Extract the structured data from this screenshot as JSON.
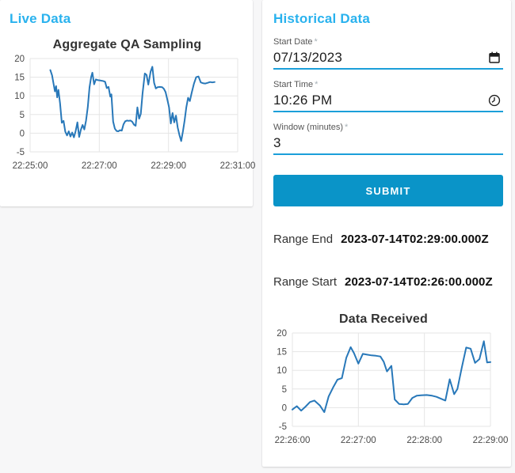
{
  "panels": {
    "live": {
      "heading": "Live Data"
    },
    "historical": {
      "heading": "Historical Data"
    }
  },
  "form": {
    "start_date": {
      "label": "Start Date",
      "required_marker": "*",
      "value": "07/13/2023",
      "icon": "calendar-icon"
    },
    "start_time": {
      "label": "Start Time",
      "required_marker": "*",
      "value": "10:26 PM",
      "icon": "clock-icon"
    },
    "window_minutes": {
      "label": "Window (minutes)",
      "required_marker": "*",
      "value": "3"
    },
    "submit_label": "SUBMIT"
  },
  "results": {
    "range_end": {
      "label": "Range End",
      "value": "2023-07-14T02:29:00.000Z"
    },
    "range_start": {
      "label": "Range Start",
      "value": "2023-07-14T02:26:00.000Z"
    }
  },
  "colors": {
    "page_background": "#f7f7f8",
    "card_background": "#ffffff",
    "panel_heading": "#29b2ee",
    "input_underline": "#1b9fd9",
    "submit_background": "#0a94c8",
    "submit_text": "#ffffff",
    "chart_line": "#2878b9",
    "chart_grid": "#e5e5e5",
    "chart_tick_text": "#4a4a4a",
    "chart_title_text": "#333333",
    "field_label_text": "#565656",
    "field_value_text": "#1d1d1d"
  },
  "chart_data": [
    {
      "id": "live",
      "type": "line",
      "title": "Aggregate QA Sampling",
      "xlabel": "",
      "ylabel": "",
      "grid": true,
      "legend": "none",
      "line_color": "#2878b9",
      "x_tick_labels": [
        "22:25:00",
        "22:27:00",
        "22:29:00",
        "22:31:00"
      ],
      "x_tick_seconds": [
        0,
        120,
        240,
        360
      ],
      "x_range_seconds": [
        0,
        360
      ],
      "y_ticks": [
        -5,
        0,
        5,
        10,
        15,
        20
      ],
      "ylim": [
        -5,
        20
      ],
      "points": [
        [
          35,
          16.9
        ],
        [
          38,
          15.5
        ],
        [
          41,
          13.0
        ],
        [
          43,
          11.2
        ],
        [
          45,
          12.6
        ],
        [
          47,
          9.6
        ],
        [
          49,
          11.6
        ],
        [
          52,
          8.0
        ],
        [
          55,
          2.8
        ],
        [
          58,
          3.3
        ],
        [
          61,
          0.4
        ],
        [
          64,
          -0.6
        ],
        [
          67,
          0.5
        ],
        [
          70,
          -0.9
        ],
        [
          73,
          0.2
        ],
        [
          76,
          -1.1
        ],
        [
          79,
          0.6
        ],
        [
          82,
          2.9
        ],
        [
          85,
          -1.0
        ],
        [
          88,
          0.9
        ],
        [
          91,
          2.2
        ],
        [
          94,
          1.0
        ],
        [
          97,
          3.4
        ],
        [
          100,
          7.0
        ],
        [
          103,
          12.3
        ],
        [
          106,
          15.1
        ],
        [
          108,
          16.2
        ],
        [
          111,
          13.1
        ],
        [
          114,
          14.4
        ],
        [
          118,
          14.2
        ],
        [
          122,
          14.1
        ],
        [
          126,
          14.0
        ],
        [
          130,
          13.8
        ],
        [
          133,
          12.1
        ],
        [
          136,
          12.4
        ],
        [
          139,
          9.8
        ],
        [
          141,
          10.4
        ],
        [
          144,
          3.1
        ],
        [
          147,
          1.2
        ],
        [
          150,
          0.6
        ],
        [
          153,
          0.5
        ],
        [
          156,
          0.8
        ],
        [
          159,
          0.7
        ],
        [
          162,
          2.4
        ],
        [
          165,
          3.2
        ],
        [
          168,
          3.4
        ],
        [
          171,
          3.3
        ],
        [
          174,
          3.4
        ],
        [
          177,
          3.1
        ],
        [
          180,
          2.3
        ],
        [
          183,
          2.0
        ],
        [
          186,
          6.9
        ],
        [
          189,
          3.9
        ],
        [
          192,
          5.2
        ],
        [
          195,
          10.6
        ],
        [
          199,
          16.0
        ],
        [
          202,
          15.6
        ],
        [
          205,
          13.0
        ],
        [
          209,
          16.5
        ],
        [
          212,
          17.8
        ],
        [
          215,
          13.5
        ],
        [
          218,
          12.0
        ],
        [
          221,
          12.3
        ],
        [
          225,
          12.4
        ],
        [
          229,
          12.3
        ],
        [
          232,
          11.9
        ],
        [
          235,
          11.0
        ],
        [
          238,
          9.0
        ],
        [
          241,
          6.9
        ],
        [
          244,
          2.6
        ],
        [
          247,
          5.4
        ],
        [
          250,
          2.9
        ],
        [
          253,
          4.7
        ],
        [
          256,
          1.5
        ],
        [
          259,
          -0.5
        ],
        [
          262,
          -2.1
        ],
        [
          265,
          0.5
        ],
        [
          268,
          3.4
        ],
        [
          271,
          7.0
        ],
        [
          274,
          9.5
        ],
        [
          277,
          8.6
        ],
        [
          280,
          10.7
        ],
        [
          284,
          13.2
        ],
        [
          288,
          15.0
        ],
        [
          292,
          15.2
        ],
        [
          296,
          13.6
        ],
        [
          300,
          13.4
        ],
        [
          304,
          13.3
        ],
        [
          308,
          13.5
        ],
        [
          312,
          13.7
        ],
        [
          316,
          13.6
        ],
        [
          320,
          13.7
        ]
      ]
    },
    {
      "id": "hist",
      "type": "line",
      "title": "Data Received",
      "xlabel": "",
      "ylabel": "",
      "grid": true,
      "legend": "none",
      "line_color": "#2878b9",
      "x_tick_labels": [
        "22:26:00",
        "22:27:00",
        "22:28:00",
        "22:29:00"
      ],
      "x_tick_seconds": [
        0,
        60,
        120,
        180
      ],
      "x_range_seconds": [
        0,
        180
      ],
      "y_ticks": [
        -5,
        0,
        5,
        10,
        15,
        20
      ],
      "ylim": [
        -5,
        20
      ],
      "points": [
        [
          0,
          -0.5
        ],
        [
          4,
          0.4
        ],
        [
          8,
          -0.8
        ],
        [
          12,
          0.3
        ],
        [
          16,
          1.5
        ],
        [
          20,
          1.9
        ],
        [
          25,
          0.6
        ],
        [
          29,
          -1.2
        ],
        [
          33,
          3.0
        ],
        [
          37,
          5.4
        ],
        [
          41,
          7.5
        ],
        [
          45,
          7.9
        ],
        [
          49,
          13.4
        ],
        [
          53,
          16.2
        ],
        [
          56,
          14.6
        ],
        [
          60,
          11.8
        ],
        [
          64,
          14.4
        ],
        [
          68,
          14.2
        ],
        [
          72,
          14.0
        ],
        [
          76,
          13.9
        ],
        [
          80,
          13.7
        ],
        [
          83,
          12.3
        ],
        [
          86,
          9.7
        ],
        [
          90,
          11.2
        ],
        [
          93,
          2.2
        ],
        [
          97,
          1.0
        ],
        [
          101,
          0.9
        ],
        [
          105,
          1.0
        ],
        [
          109,
          2.6
        ],
        [
          113,
          3.2
        ],
        [
          117,
          3.3
        ],
        [
          122,
          3.4
        ],
        [
          127,
          3.2
        ],
        [
          131,
          2.9
        ],
        [
          135,
          2.4
        ],
        [
          139,
          1.9
        ],
        [
          143,
          7.6
        ],
        [
          147,
          3.6
        ],
        [
          150,
          5.0
        ],
        [
          154,
          10.8
        ],
        [
          158,
          16.1
        ],
        [
          162,
          15.8
        ],
        [
          166,
          12.0
        ],
        [
          170,
          13.0
        ],
        [
          174,
          17.8
        ],
        [
          177,
          12.1
        ],
        [
          180,
          12.2
        ]
      ]
    }
  ]
}
